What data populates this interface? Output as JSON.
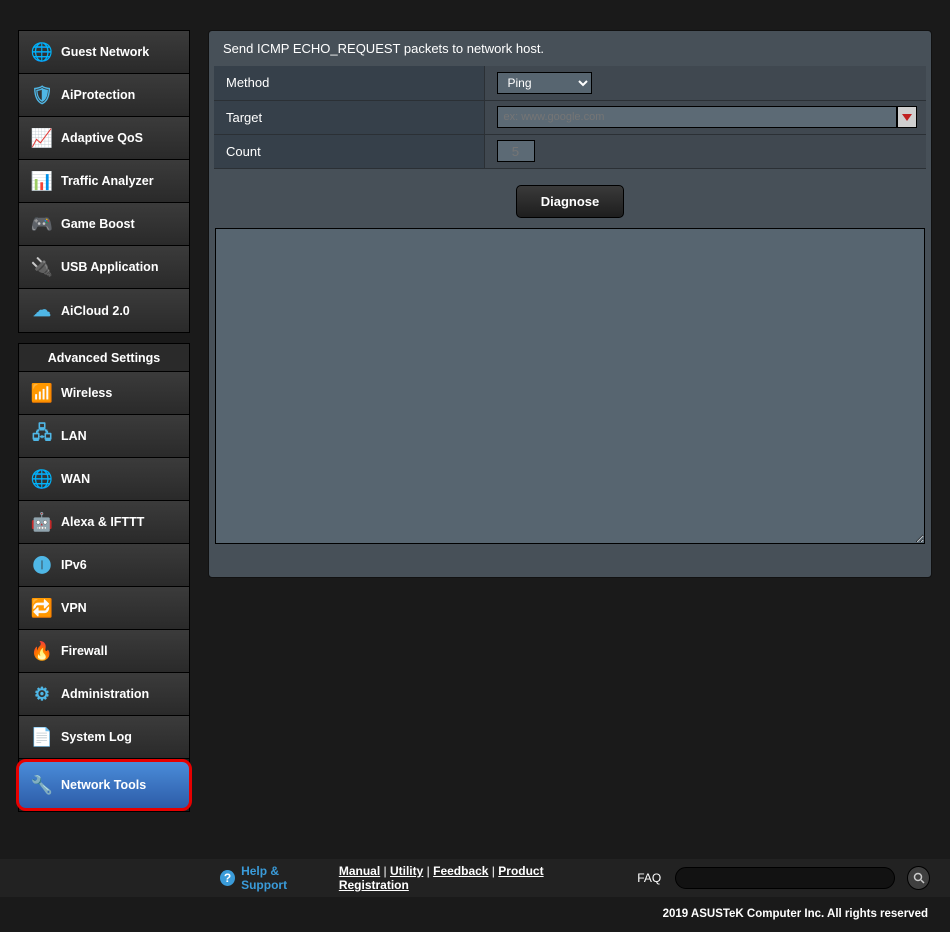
{
  "sidebar": {
    "general_items": [
      {
        "key": "guest-network",
        "label": "Guest Network",
        "icon": "🌐"
      },
      {
        "key": "aiprotection",
        "label": "AiProtection",
        "icon": "🛡"
      },
      {
        "key": "adaptive-qos",
        "label": "Adaptive QoS",
        "icon": "📈"
      },
      {
        "key": "traffic-analyzer",
        "label": "Traffic Analyzer",
        "icon": "📊"
      },
      {
        "key": "game-boost",
        "label": "Game Boost",
        "icon": "🎮"
      },
      {
        "key": "usb-application",
        "label": "USB Application",
        "icon": "🔌"
      },
      {
        "key": "aicloud",
        "label": "AiCloud 2.0",
        "icon": "☁"
      }
    ],
    "advanced_header": "Advanced Settings",
    "advanced_items": [
      {
        "key": "wireless",
        "label": "Wireless",
        "icon": "📶"
      },
      {
        "key": "lan",
        "label": "LAN",
        "icon": "🖧"
      },
      {
        "key": "wan",
        "label": "WAN",
        "icon": "🌐"
      },
      {
        "key": "alexa-ifttt",
        "label": "Alexa & IFTTT",
        "icon": "🤖"
      },
      {
        "key": "ipv6",
        "label": "IPv6",
        "icon": "🅘"
      },
      {
        "key": "vpn",
        "label": "VPN",
        "icon": "🔁"
      },
      {
        "key": "firewall",
        "label": "Firewall",
        "icon": "🔥"
      },
      {
        "key": "administration",
        "label": "Administration",
        "icon": "⚙"
      },
      {
        "key": "system-log",
        "label": "System Log",
        "icon": "📄"
      },
      {
        "key": "network-tools",
        "label": "Network Tools",
        "icon": "🔧",
        "active": true,
        "highlighted": true
      }
    ]
  },
  "main": {
    "description": "Send ICMP ECHO_REQUEST packets to network host.",
    "method_label": "Method",
    "method_value": "Ping",
    "target_label": "Target",
    "target_placeholder": "ex: www.google.com",
    "target_value": "",
    "count_label": "Count",
    "count_placeholder": "5",
    "count_value": "",
    "diagnose_label": "Diagnose",
    "result_value": ""
  },
  "footer": {
    "help_label": "Help & Support",
    "links": [
      "Manual",
      "Utility",
      "Feedback",
      "Product Registration"
    ],
    "faq_label": "FAQ",
    "copyright": "2019 ASUSTeK Computer Inc. All rights reserved"
  }
}
